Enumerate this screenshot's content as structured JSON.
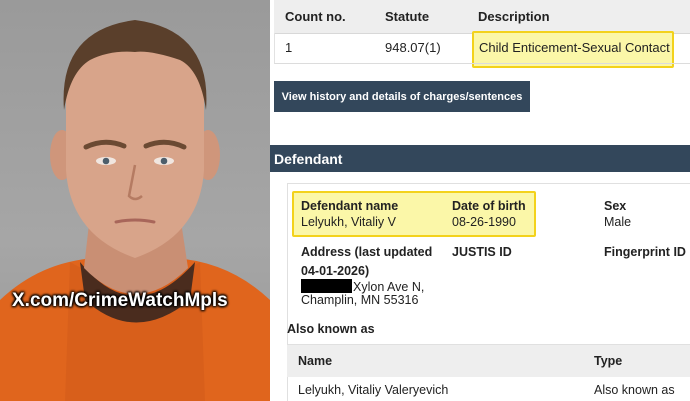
{
  "photo": {
    "watermark": "X.com/CrimeWatchMpls",
    "colors": {
      "background": "#a2a2a2",
      "shirt": "#e0651d",
      "undershirt": "#4a2c1e",
      "skin": "#d8a48a",
      "hair": "#5a3f2b"
    }
  },
  "charges": {
    "columns": [
      "Count no.",
      "Statute",
      "Description"
    ],
    "rows": [
      {
        "count": "1",
        "statute": "948.07(1)",
        "description": "Child Enticement-Sexual Contact"
      }
    ],
    "history_button": "View history and details of charges/sentences"
  },
  "defendant": {
    "section_title": "Defendant",
    "name_label": "Defendant name",
    "name_value": "Lelyukh, Vitaliy V",
    "dob_label": "Date of birth",
    "dob_value": "08-26-1990",
    "sex_label": "Sex",
    "sex_value": "Male",
    "address_label_line1": "Address (last updated",
    "address_label_line2": "04-01-2026)",
    "address_line1": "Xylon Ave N,",
    "address_line2": "Champlin, MN 55316",
    "justis_label": "JUSTIS ID",
    "fingerprint_label": "Fingerprint ID"
  },
  "aka": {
    "title": "Also known as",
    "columns": [
      "Name",
      "Type"
    ],
    "rows": [
      {
        "name": "Lelyukh, Vitaliy Valeryevich",
        "type": "Also known as"
      }
    ]
  },
  "colors": {
    "header_bar": "#33475b",
    "highlight": "#fbf7a8",
    "highlight_border": "#f3d21c",
    "table_header": "#eeeeee"
  }
}
